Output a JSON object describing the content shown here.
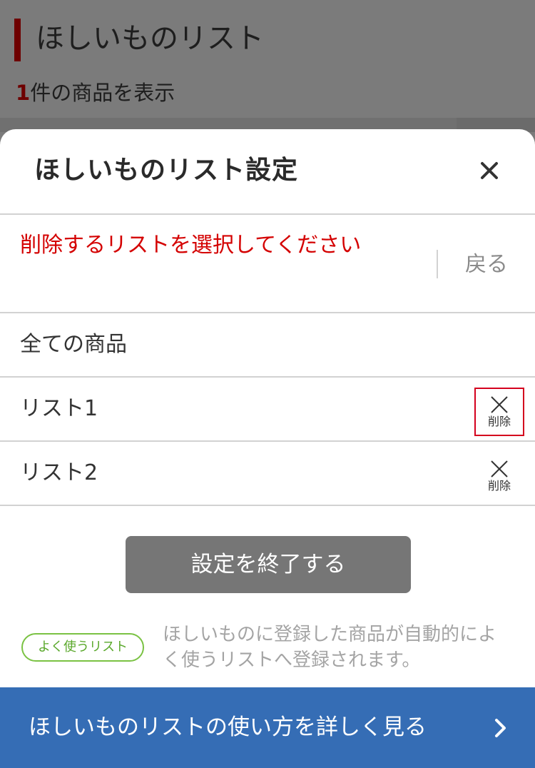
{
  "background": {
    "title": "ほしいものリスト",
    "count_number": "1",
    "count_suffix": "件の商品を表示"
  },
  "modal": {
    "title": "ほしいものリスト設定",
    "close_icon": "close-icon",
    "instruction": "削除するリストを選択してください",
    "back_label": "戻る",
    "lists": [
      {
        "label": "全ての商品",
        "deletable": false
      },
      {
        "label": "リスト1",
        "deletable": true,
        "delete_label": "削除",
        "highlighted": true
      },
      {
        "label": "リスト2",
        "deletable": true,
        "delete_label": "削除",
        "highlighted": false
      }
    ],
    "finish_label": "設定を終了する",
    "badge_label": "よく使うリスト",
    "note": "ほしいものに登録した商品が自動的によく使うリストへ登録されます。",
    "footer_label": "ほしいものリストの使い方を詳しく見る",
    "footer_icon": "chevron-right-icon"
  },
  "colors": {
    "accent_red": "#d40000",
    "footer_blue": "#356db5",
    "badge_green": "#7ac243",
    "button_gray": "#767676"
  }
}
